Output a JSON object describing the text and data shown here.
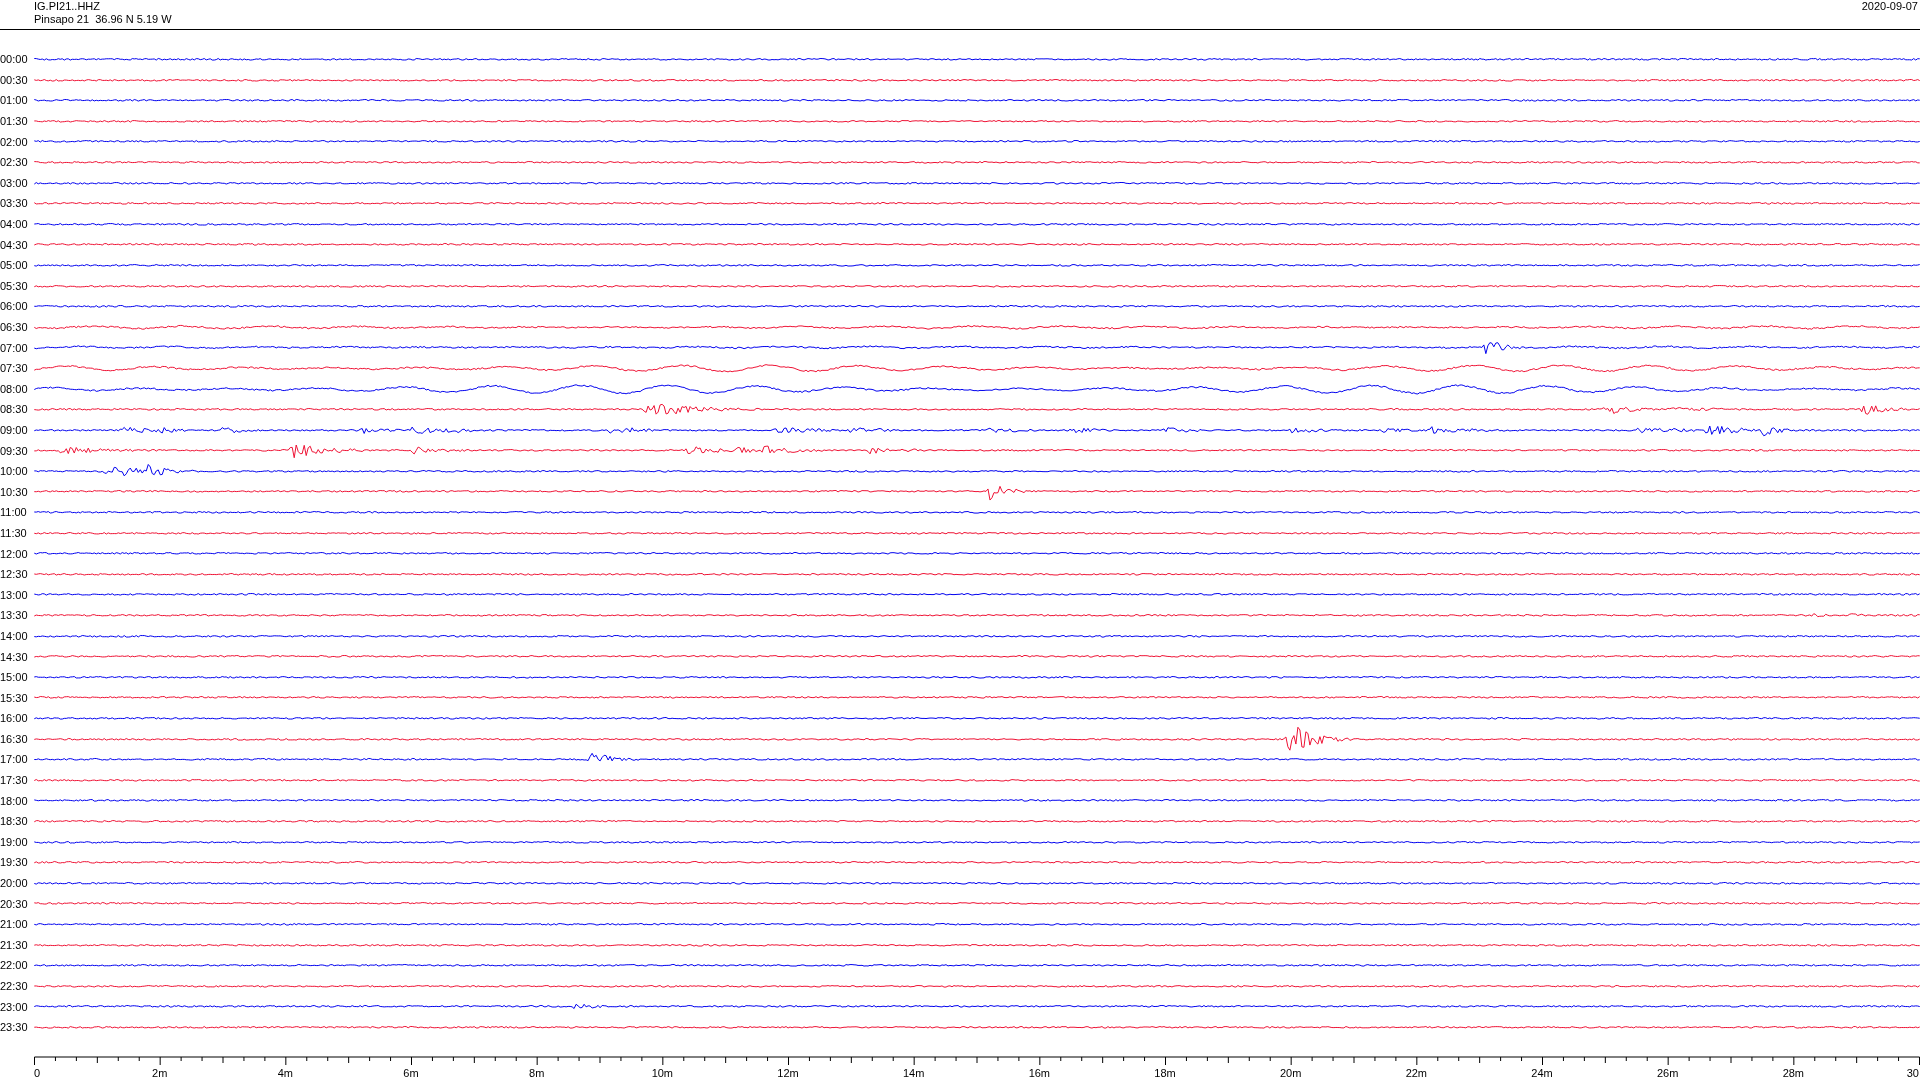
{
  "header": {
    "channel": "IG.PI21..HHZ",
    "station": "Pinsapo 21  36.96 N 5.19 W",
    "date": "2020-09-07"
  },
  "rows": [
    {
      "time": "00:00",
      "color": "#0000ee"
    },
    {
      "time": "00:30",
      "color": "#ee1133"
    },
    {
      "time": "01:00",
      "color": "#0000ee"
    },
    {
      "time": "01:30",
      "color": "#ee1133"
    },
    {
      "time": "02:00",
      "color": "#0000ee"
    },
    {
      "time": "02:30",
      "color": "#ee1133"
    },
    {
      "time": "03:00",
      "color": "#0000ee"
    },
    {
      "time": "03:30",
      "color": "#ee1133"
    },
    {
      "time": "04:00",
      "color": "#0000ee"
    },
    {
      "time": "04:30",
      "color": "#ee1133"
    },
    {
      "time": "05:00",
      "color": "#0000ee"
    },
    {
      "time": "05:30",
      "color": "#ee1133"
    },
    {
      "time": "06:00",
      "color": "#0000ee"
    },
    {
      "time": "06:30",
      "color": "#ee1133"
    },
    {
      "time": "07:00",
      "color": "#0000ee"
    },
    {
      "time": "07:30",
      "color": "#ee1133"
    },
    {
      "time": "08:00",
      "color": "#0000ee"
    },
    {
      "time": "08:30",
      "color": "#ee1133"
    },
    {
      "time": "09:00",
      "color": "#0000ee"
    },
    {
      "time": "09:30",
      "color": "#ee1133"
    },
    {
      "time": "10:00",
      "color": "#0000ee"
    },
    {
      "time": "10:30",
      "color": "#ee1133"
    },
    {
      "time": "11:00",
      "color": "#0000ee"
    },
    {
      "time": "11:30",
      "color": "#ee1133"
    },
    {
      "time": "12:00",
      "color": "#0000ee"
    },
    {
      "time": "12:30",
      "color": "#ee1133"
    },
    {
      "time": "13:00",
      "color": "#0000ee"
    },
    {
      "time": "13:30",
      "color": "#ee1133"
    },
    {
      "time": "14:00",
      "color": "#0000ee"
    },
    {
      "time": "14:30",
      "color": "#ee1133"
    },
    {
      "time": "15:00",
      "color": "#0000ee"
    },
    {
      "time": "15:30",
      "color": "#ee1133"
    },
    {
      "time": "16:00",
      "color": "#0000ee"
    },
    {
      "time": "16:30",
      "color": "#ee1133"
    },
    {
      "time": "17:00",
      "color": "#0000ee"
    },
    {
      "time": "17:30",
      "color": "#ee1133"
    },
    {
      "time": "18:00",
      "color": "#0000ee"
    },
    {
      "time": "18:30",
      "color": "#ee1133"
    },
    {
      "time": "19:00",
      "color": "#0000ee"
    },
    {
      "time": "19:30",
      "color": "#ee1133"
    },
    {
      "time": "20:00",
      "color": "#0000ee"
    },
    {
      "time": "20:30",
      "color": "#ee1133"
    },
    {
      "time": "21:00",
      "color": "#0000ee"
    },
    {
      "time": "21:30",
      "color": "#ee1133"
    },
    {
      "time": "22:00",
      "color": "#0000ee"
    },
    {
      "time": "22:30",
      "color": "#ee1133"
    },
    {
      "time": "23:00",
      "color": "#0000ee"
    },
    {
      "time": "23:30",
      "color": "#ee1133"
    }
  ],
  "axis_labels": [
    "0",
    "2m",
    "4m",
    "6m",
    "8m",
    "10m",
    "12m",
    "14m",
    "16m",
    "18m",
    "20m",
    "22m",
    "24m",
    "26m",
    "28m",
    "30"
  ]
}
